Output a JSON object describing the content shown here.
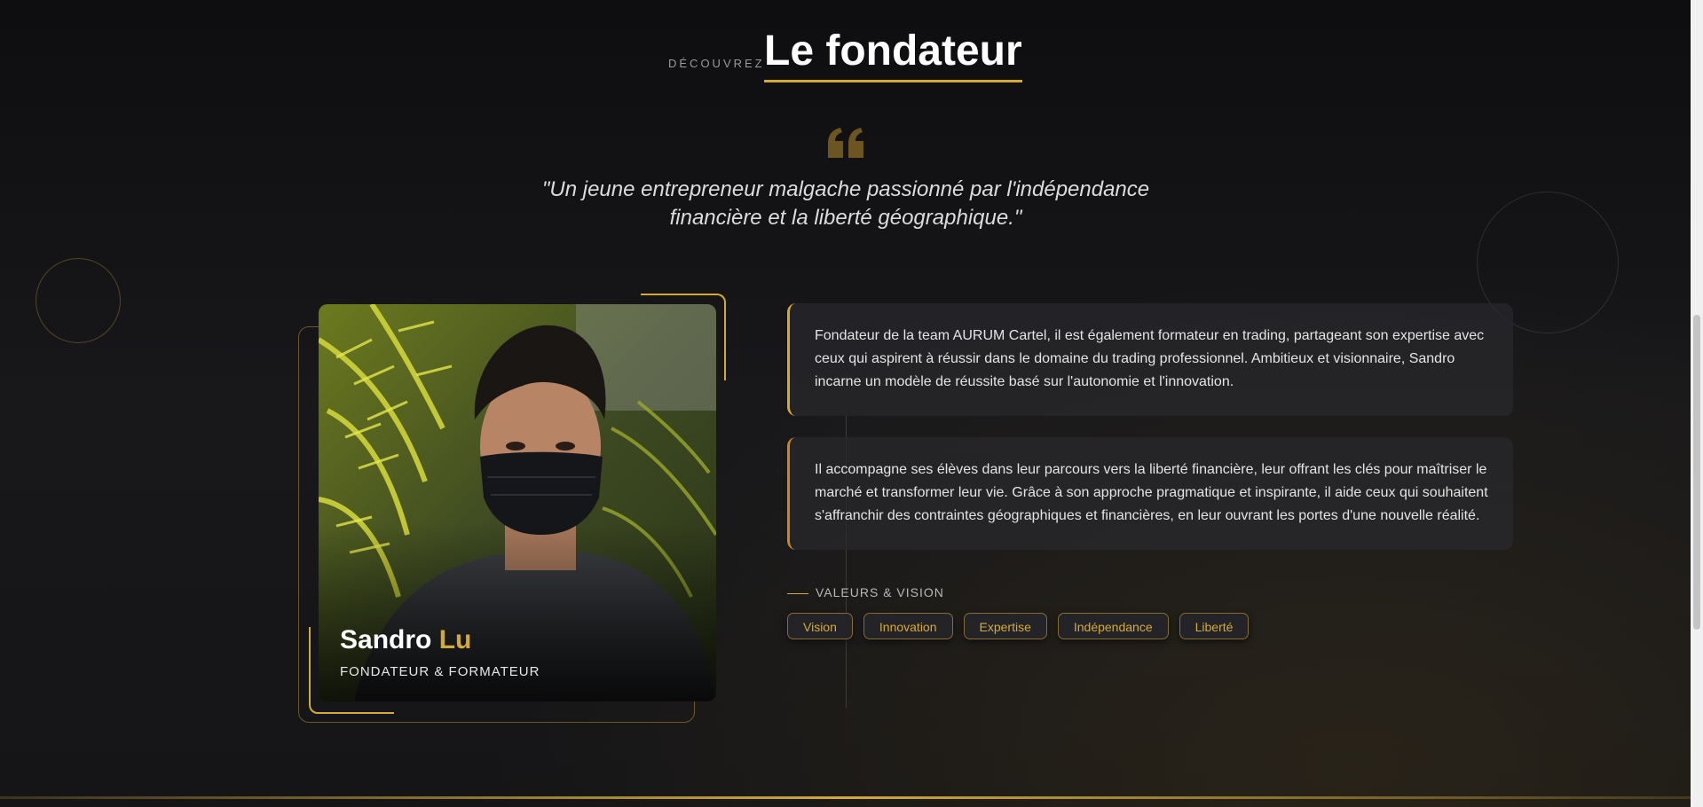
{
  "header": {
    "eyebrow": "DÉCOUVREZ",
    "title": "Le fondateur"
  },
  "quote": {
    "icon": "quote-icon",
    "text": "\"Un jeune entrepreneur malgache passionné par l'indépendance financière et la liberté géographique.\""
  },
  "founder": {
    "first_name": "Sandro",
    "last_name": "Lu",
    "role": "FONDATEUR & FORMATEUR"
  },
  "cards": [
    {
      "text": "Fondateur de la team AURUM Cartel, il est également formateur en trading, partageant son expertise avec ceux qui aspirent à réussir dans le domaine du trading professionnel. Ambitieux et visionnaire, Sandro incarne un modèle de réussite basé sur l'autonomie et l'innovation."
    },
    {
      "text": "Il accompagne ses élèves dans leur parcours vers la liberté financière, leur offrant les clés pour maîtriser le marché et transformer leur vie. Grâce à son approche pragmatique et inspirante, il aide ceux qui souhaitent s'affranchir des contraintes géographiques et financières, en leur ouvrant les portes d'une nouvelle réalité."
    }
  ],
  "values": {
    "label": "VALEURS & VISION",
    "tags": [
      "Vision",
      "Innovation",
      "Expertise",
      "Indépendance",
      "Liberté"
    ]
  },
  "colors": {
    "accent": "#d4a937",
    "background": "#131315",
    "card": "#28282c"
  }
}
